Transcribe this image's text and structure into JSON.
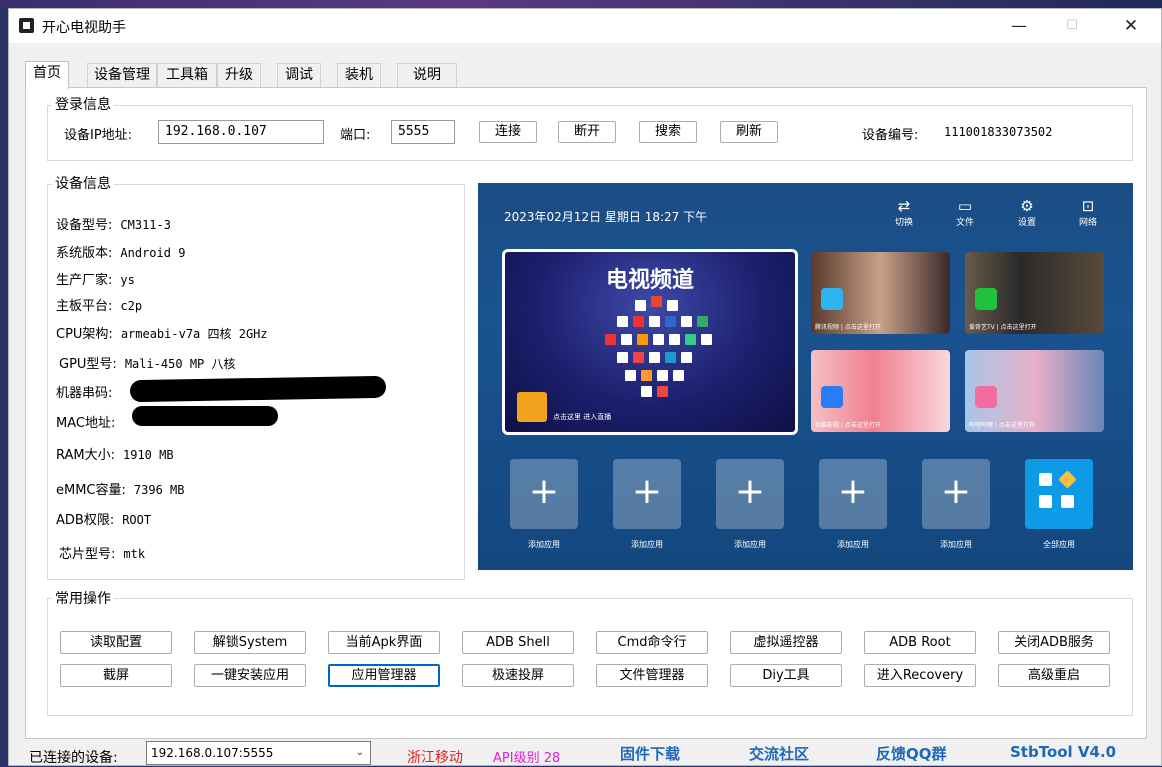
{
  "window": {
    "title": "开心电视助手"
  },
  "tabs": [
    "首页",
    "设备管理",
    "工具箱",
    "升级",
    "调试",
    "装机",
    "说明"
  ],
  "login": {
    "group_title": "登录信息",
    "ip_label": "设备IP地址:",
    "ip_value": "192.168.0.107",
    "port_label": "端口:",
    "port_value": "5555",
    "buttons": [
      "连接",
      "断开",
      "搜索",
      "刷新"
    ],
    "device_no_label": "设备编号:",
    "device_no_value": "111001833073502"
  },
  "device_info": {
    "group_title": "设备信息",
    "rows": [
      {
        "label": "设备型号:",
        "value": "CM311-3"
      },
      {
        "label": "系统版本:",
        "value": "Android 9"
      },
      {
        "label": "生产厂家:",
        "value": "ys"
      },
      {
        "label": "主板平台:",
        "value": "c2p"
      },
      {
        "label": "CPU架构:",
        "value": "armeabi-v7a 四核 2GHz"
      },
      {
        "label": "GPU型号:",
        "value": "Mali-450 MP 八核"
      },
      {
        "label": "机器串码:",
        "value": ""
      },
      {
        "label": "MAC地址:",
        "value": ""
      },
      {
        "label": "RAM大小:",
        "value": "1910 MB"
      },
      {
        "label": "eMMC容量:",
        "value": "7396 MB"
      },
      {
        "label": "ADB权限:",
        "value": "ROOT"
      },
      {
        "label": "芯片型号:",
        "value": "mtk"
      }
    ]
  },
  "tv_screen": {
    "datetime": "2023年02月12日 星期日 18:27 下午",
    "top_icons": [
      {
        "icon": "switch-icon",
        "label": "切换"
      },
      {
        "icon": "folder-icon",
        "label": "文件"
      },
      {
        "icon": "settings-icon",
        "label": "设置"
      },
      {
        "icon": "network-icon",
        "label": "网络"
      }
    ],
    "main_card_title": "电视频道",
    "main_card_caption": "点击这里 进入直播",
    "app_cards": [
      {
        "caption": "腾讯视频  | 点击这里打开",
        "badge_color": "#2db5ef"
      },
      {
        "caption": "爱奇艺TV  | 点击这里打开",
        "badge_color": "#1fc23a"
      },
      {
        "caption": "优酷影视  | 点击这里打开",
        "badge_color": "#2a7cf6"
      },
      {
        "caption": "哔哩哔哩  | 点击这里打开",
        "badge_color": "#f36ea0"
      }
    ],
    "add_app_label": "添加应用",
    "all_apps_label": "全部应用"
  },
  "ops": {
    "group_title": "常用操作",
    "row1": [
      "读取配置",
      "解锁System",
      "当前Apk界面",
      "ADB Shell",
      "Cmd命令行",
      "虚拟遥控器",
      "ADB  Root",
      "关闭ADB服务"
    ],
    "row2": [
      "截屏",
      "一键安装应用",
      "应用管理器",
      "极速投屏",
      "文件管理器",
      "Diy工具",
      "进入Recovery",
      "高级重启"
    ]
  },
  "status": {
    "connected_label": "已连接的设备:",
    "connected_value": "192.168.0.107:5555",
    "carrier": "浙江移动",
    "api_level": "API级别 28",
    "links": [
      "固件下载",
      "交流社区",
      "反馈QQ群",
      "StbTool V4.0"
    ],
    "colors": {
      "carrier": "#e02020",
      "api": "#e020d0",
      "link": "#1c68b9"
    }
  }
}
